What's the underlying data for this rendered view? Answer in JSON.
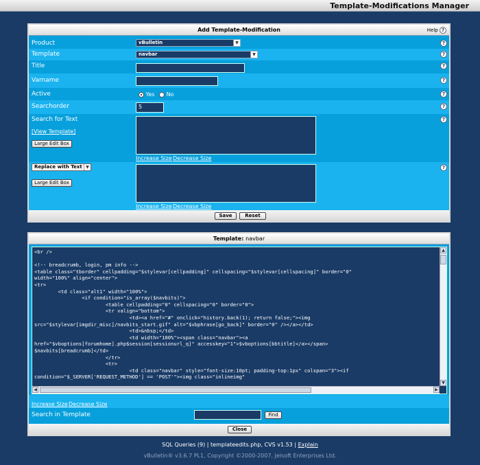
{
  "header": {
    "title": "Template-Modifications Manager"
  },
  "add_panel": {
    "title": "Add Template-Modification",
    "help_label": "Help",
    "help_icon": "?",
    "product": {
      "label": "Product",
      "value": "vBulletin"
    },
    "template": {
      "label": "Template",
      "value": "navbar"
    },
    "title_field": {
      "label": "Title",
      "value": ""
    },
    "varname": {
      "label": "Varname",
      "value": ""
    },
    "active": {
      "label": "Active",
      "yes": "Yes",
      "no": "No",
      "selected": "Yes"
    },
    "searchorder": {
      "label": "Searchorder",
      "value": "5"
    },
    "search_text": {
      "label": "Search for Text",
      "view_template": "[View Template]",
      "large_edit": "Large Edit Box",
      "increase": "Increase Size",
      "decrease": "Decrease Size"
    },
    "replace": {
      "mode": "Replace with Text",
      "large_edit": "Large Edit Box",
      "increase": "Increase Size",
      "decrease": "Decrease Size"
    },
    "save_label": "Save",
    "reset_label": "Reset"
  },
  "template_panel": {
    "title_prefix": "Template:",
    "title_name": "navbar",
    "code": "<br />\n\n<!-- breadcrumb, login, pm info -->\n<table class=\"tborder\" cellpadding=\"$stylevar[cellpadding]\" cellspacing=\"$stylevar[cellspacing]\" border=\"0\"\nwidth=\"100%\" align=\"center\">\n<tr>\n        <td class=\"alt1\" width=\"100%\">\n                <if condition=\"is_array($navbits)\">\n                        <table cellpadding=\"0\" cellspacing=\"0\" border=\"0\">\n                        <tr valign=\"bottom\">\n                                <td><a href=\"#\" onclick=\"history.back(1); return false;\"><img\nsrc=\"$stylevar[imgdir_misc]/navbits_start.gif\" alt=\"$vbphrase[go_back]\" border=\"0\" /></a></td>\n                                <td>&nbsp;</td>\n                                <td width=\"100%\"><span class=\"navbar\"><a\nhref=\"$vboptions[forumhome].php$session[sessionurl_q]\" accesskey=\"1\">$vboptions[bbtitle]</a></span>\n$navbits[breadcrumb]</td>\n                        </tr>\n                        <tr>\n                                <td class=\"navbar\" style=\"font-size:10pt; padding-top:1px\" colspan=\"3\"><if\ncondition=\"$_SERVER['REQUEST_METHOD'] == 'POST'\"><img class=\"inlineimg\"",
    "increase": "Increase Size",
    "decrease": "Decrease Size",
    "search_label": "Search in Template",
    "search_value": "",
    "find_label": "Find",
    "close_label": "Close"
  },
  "footer": {
    "queries": "SQL Queries (9) | templateedits.php, CVS v1.53 |",
    "explain": "Explain",
    "copyright": "vBulletin® v3.6.7 PL1, Copyright ©2000-2007, Jelsoft Enterprises Ltd."
  }
}
